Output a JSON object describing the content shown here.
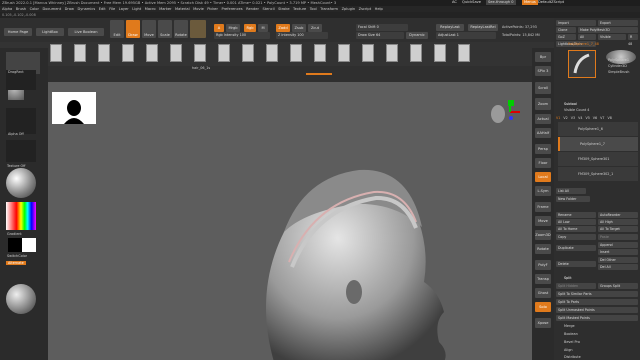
{
  "titlebar": {
    "text": "ZBrush 2022.0.1 [Marcus Whinney]   ZBrush Document   • Free Mem 19.695GB • Active Mem 2095 • Scratch Disk 49 • Timer• 0.001 ATime• 0.021 • PolyCount • 3.719 MP • MeshCount• 3",
    "ac": "AC",
    "quicksave": "QuickSave",
    "seethrough": "See-through  0",
    "menus": "Menus",
    "defaultscript": "DefaultZScript"
  },
  "menus": [
    "Alpha",
    "Brush",
    "Color",
    "Document",
    "Draw",
    "Dynamics",
    "Edit",
    "File",
    "Layer",
    "Light",
    "Macro",
    "Marker",
    "Material",
    "Movie",
    "Picker",
    "Preferences",
    "Render",
    "Stencil",
    "Stroke",
    "Texture",
    "Tool",
    "Transform",
    "Zplugin",
    "Zscript",
    "Help"
  ],
  "subbar": "0.105,-0.102,-0.008",
  "top_tabs": {
    "home": "Home Page",
    "lightbox": "LightBox",
    "live_boolean": "Live Boolean"
  },
  "modes": {
    "edit": "Edit",
    "draw": "Draw",
    "move": "Move",
    "scale": "Scale",
    "rotate": "Rotate"
  },
  "draw_params": {
    "a": "A",
    "mrgb": "Mrgb",
    "rgb": "Rgb",
    "m": "M",
    "zadd": "Zadd",
    "zsub": "Zsub",
    "zcut": "Zcut",
    "rgb_intensity": "Rgb Intensity 100",
    "z_intensity": "Z Intensity 100",
    "focal_shift": "Focal Shift 0",
    "draw_size": "Draw Size 64",
    "dynamic": "Dynamic",
    "replay_last": "ReplayLast",
    "replay_last_rel": "ReplayLastRel",
    "adjust_last": "AdjustLast 1",
    "active_points": "ActivePoints: 37,293",
    "total_points": "TotalPoints: 15,842 Mil"
  },
  "brush_strip_label": "hair_06_1s",
  "left": {
    "alpha_off": "Alpha Off",
    "texture_off": "Texture Off",
    "gradient": "Gradient",
    "switch_color": "SwitchColor",
    "alternate": "Alternate",
    "stroke": "DragRect"
  },
  "right_panel": {
    "import": "Import",
    "export": "Export",
    "clone": "Clone",
    "make_polymesh": "Make PolyMesh3D",
    "goz": "GoZ",
    "all": "All",
    "visible": "Visible",
    "r": "R",
    "lightbox_tools": "Lightbox▸Tools",
    "polysphere": "PolySphere1_7_48",
    "polysphere_val": "48",
    "cylinder3d": "Cylinder3D",
    "simplebrush": "SimpleBrush",
    "polysphere1": "PolySphere1",
    "subtool": "Subtool",
    "visible_count": "Visible Count 4",
    "v_tabs": [
      "V1",
      "V2",
      "V3",
      "V4",
      "V5",
      "V6",
      "V7",
      "V8"
    ],
    "subtools": [
      "PolySphere1_6",
      "PolySphere1_7",
      "FM309_Sphere301",
      "FM309_Sphere302_1"
    ],
    "list_all": "List All",
    "new_folder": "New Folder",
    "rename": "Rename",
    "autoreorder": "AutoReorder",
    "all_low": "All Low",
    "all_high": "All High",
    "all_to_home": "All To Home",
    "all_to_target": "All To Target",
    "copy": "Copy",
    "paste": "Paste",
    "duplicate": "Duplicate",
    "append": "Append",
    "insert": "Insert",
    "del_other": "Del Other",
    "delete": "Delete",
    "del_all": "Del All",
    "split": "Split",
    "split_hidden": "Split Hidden",
    "groups_split": "Groups Split",
    "split_similar": "Split To Similar Parts",
    "split_parts": "Split To Parts",
    "split_unmasked": "Split Unmasked Points",
    "split_masked": "Split Masked Points",
    "merge": "Merge",
    "boolean": "Boolean",
    "bevel_pro": "Bevel Pro",
    "align": "Align",
    "distribute": "Distribute"
  },
  "right_shelf": [
    "Bpr",
    "SPix 3",
    "Scroll",
    "Zoom",
    "Actual",
    "AAHalf",
    "Persp",
    "Floor",
    "Local",
    "L.Sym",
    "Frame",
    "Move",
    "Zoom3D",
    "Rotate",
    "PolyF",
    "Transp",
    "Ghost",
    "Solo",
    "Xpose"
  ],
  "colors": {
    "accent": "#e07a1c",
    "viewport": "#5d5d5d",
    "panel": "#2e2e2e"
  }
}
